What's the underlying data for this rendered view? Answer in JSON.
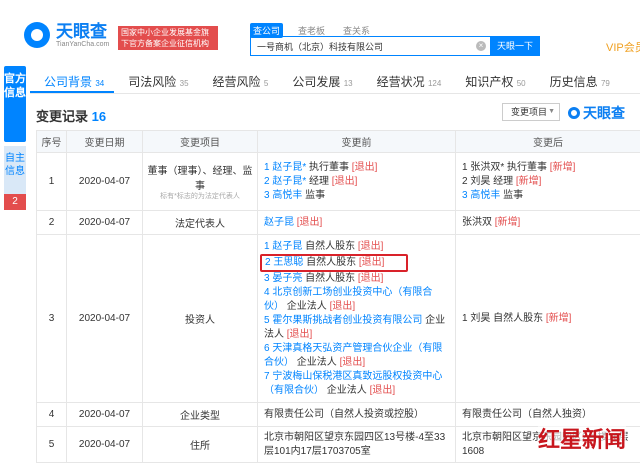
{
  "header": {
    "logo_name": "天眼查",
    "logo_sub": "TianYanCha.com",
    "cert_text": "国家中小企业发展基金旗下官方备案企业征信机构",
    "search_tabs": [
      "查公司",
      "查老板",
      "查关系"
    ],
    "search_value": "一号商机（北京）科技有限公司",
    "search_button": "天眼一下",
    "vip_label": "VIP会员"
  },
  "side": {
    "official": "官方信息",
    "self": "自主信息",
    "badge": "2"
  },
  "tabs": [
    {
      "label": "公司背景",
      "count": "34"
    },
    {
      "label": "司法风险",
      "count": "35"
    },
    {
      "label": "经营风险",
      "count": "5"
    },
    {
      "label": "公司发展",
      "count": "13"
    },
    {
      "label": "经营状况",
      "count": "124"
    },
    {
      "label": "知识产权",
      "count": "50"
    },
    {
      "label": "历史信息",
      "count": "79"
    }
  ],
  "section": {
    "title": "变更记录",
    "count": "16",
    "filter_label": "变更项目",
    "brand": "天眼查"
  },
  "table": {
    "headers": [
      "序号",
      "变更日期",
      "变更项目",
      "变更前",
      "变更后"
    ],
    "rows": [
      {
        "no": "1",
        "date": "2020-04-07",
        "item": "董事（理事）、经理、监事",
        "item_note": "标有*标志的为法定代表人",
        "before": [
          {
            "name": "1 赵子昆*",
            "role": "执行董事",
            "tag": "[退出]"
          },
          {
            "name": "2 赵子昆*",
            "role": "经理",
            "tag": "[退出]"
          },
          {
            "name": "3 高悦丰",
            "role": "监事",
            "tag": ""
          }
        ],
        "after": [
          {
            "name": "1 张洪双*",
            "role": "执行董事",
            "tag": "[新增]"
          },
          {
            "name": "2 刘昊",
            "role": "经理",
            "tag": "[新增]"
          },
          {
            "name": "3 高悦丰",
            "role": "监事",
            "tag": ""
          }
        ]
      },
      {
        "no": "2",
        "date": "2020-04-07",
        "item": "法定代表人",
        "before": [
          {
            "name": "赵子昆",
            "role": "",
            "tag": "[退出]"
          }
        ],
        "after": [
          {
            "name": "张洪双",
            "role": "",
            "tag": "[新增]"
          }
        ]
      },
      {
        "no": "3",
        "date": "2020-04-07",
        "item": "投资人",
        "before": [
          {
            "name": "1 赵子昆",
            "role": "自然人股东",
            "tag": "[退出]"
          },
          {
            "name": "2 王思聪",
            "role": "自然人股东",
            "tag": "[退出]"
          },
          {
            "name": "3 晏子亮",
            "role": "自然人股东",
            "tag": "[退出]"
          },
          {
            "name": "4 北京创新工场创业投资中心（有限合伙）",
            "role": "企业法人",
            "tag": "[退出]"
          },
          {
            "name": "5 霍尔果斯挑战者创业投资有限公司",
            "role": "企业法人",
            "tag": "[退出]"
          },
          {
            "name": "6 天津真格天弘资产管理合伙企业（有限合伙）",
            "role": "企业法人",
            "tag": "[退出]"
          },
          {
            "name": "7 宁波梅山保税港区真致远股权投资中心（有限合伙）",
            "role": "企业法人",
            "tag": "[退出]"
          }
        ],
        "after": [
          {
            "name": "1 刘昊",
            "role": "自然人股东",
            "tag": "[新增]"
          }
        ]
      },
      {
        "no": "4",
        "date": "2020-04-07",
        "item": "企业类型",
        "before_text": "有限责任公司（自然人投资或控股）",
        "after_text": "有限责任公司（自然人独资）"
      },
      {
        "no": "5",
        "date": "2020-04-07",
        "item": "住所",
        "before_text": "北京市朝阳区望京东园四区13号楼-4至33层101内17层1703705室",
        "after_text": "北京市朝阳区望京东园四区2号楼16层1608"
      }
    ]
  },
  "watermark": "红星新闻"
}
